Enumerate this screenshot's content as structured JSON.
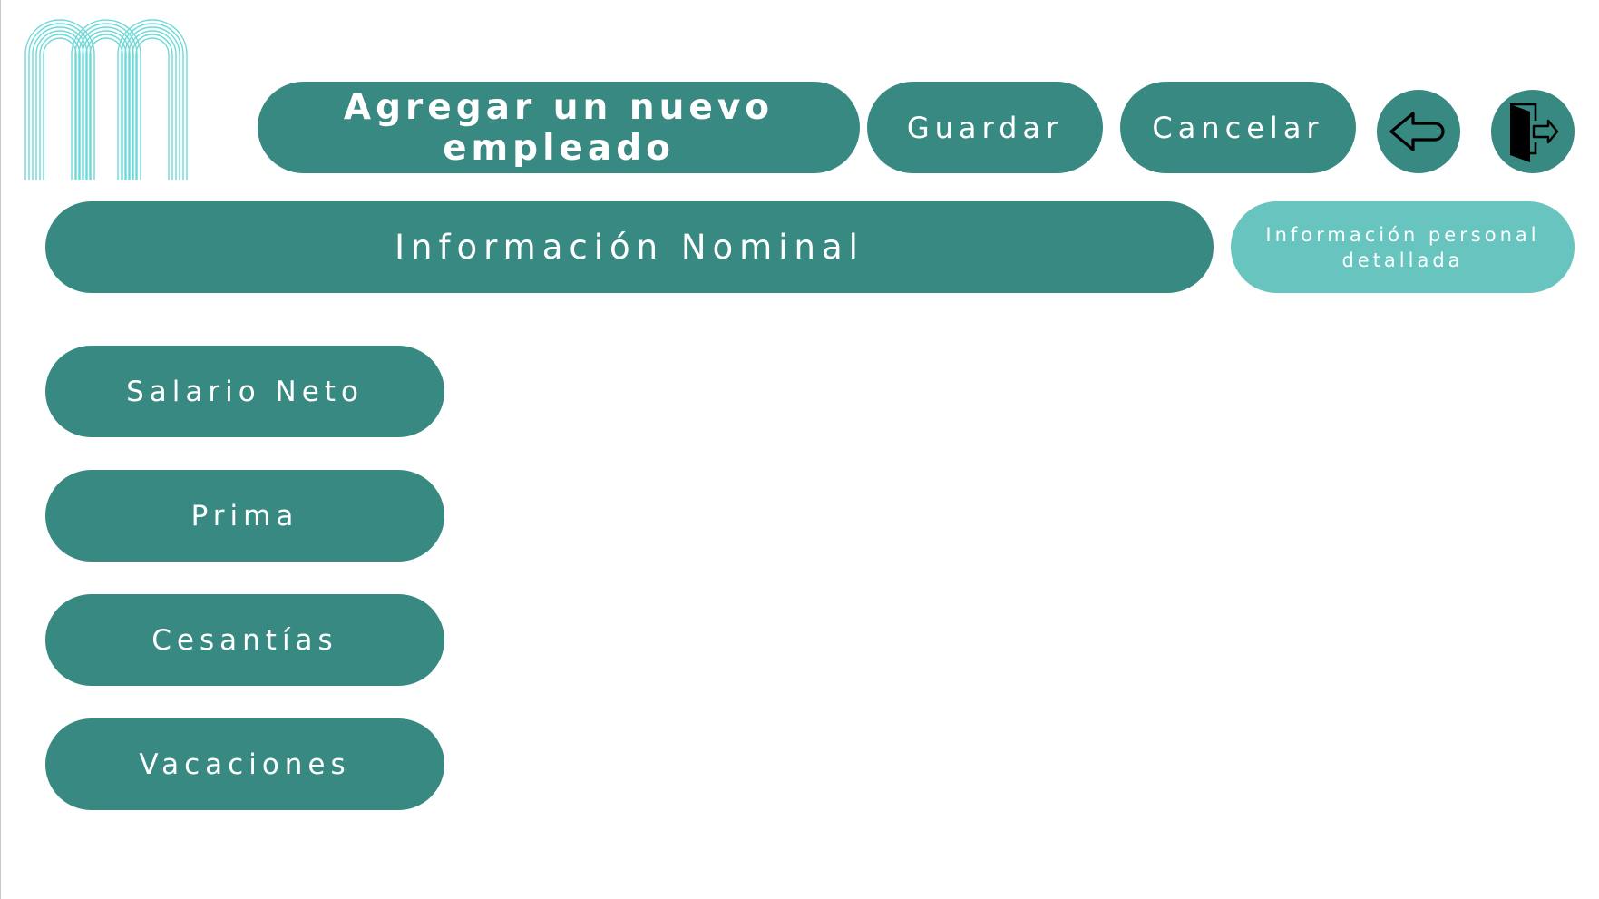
{
  "header": {
    "title": "Agregar un nuevo empleado",
    "save_label": "Guardar",
    "cancel_label": "Cancelar",
    "back_icon": "back-arrow-icon",
    "exit_icon": "exit-door-icon"
  },
  "section": {
    "title": "Información Nominal",
    "personal_tab_label": "Información personal detallada"
  },
  "menu": {
    "items": [
      {
        "label": "Salario Neto"
      },
      {
        "label": "Prima"
      },
      {
        "label": "Cesantías"
      },
      {
        "label": "Vacaciones"
      }
    ]
  },
  "colors": {
    "primary": "#378981",
    "secondary": "#67c4bf",
    "logo": "#5ed5d5",
    "text": "#ffffff"
  }
}
